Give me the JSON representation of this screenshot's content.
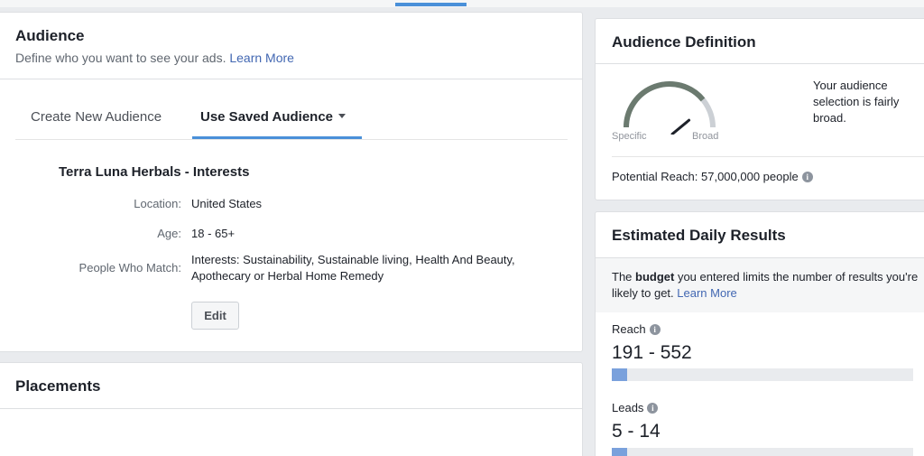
{
  "audience": {
    "title": "Audience",
    "subtitle": "Define who you want to see your ads.",
    "learn_more": "Learn More",
    "tabs": [
      {
        "label": "Create New Audience"
      },
      {
        "label": "Use Saved Audience"
      }
    ],
    "saved_name": "Terra Luna Herbals - Interests",
    "rows": {
      "location": {
        "label": "Location:",
        "value": "United States"
      },
      "age": {
        "label": "Age:",
        "value": "18 - 65+"
      },
      "people": {
        "label": "People Who Match:",
        "value_line1": "Interests: Sustainability, Sustainable living, Health And Beauty,",
        "value_line2": "Apothecary or Herbal Home Remedy"
      }
    },
    "edit_label": "Edit"
  },
  "placements": {
    "title": "Placements"
  },
  "definition": {
    "title": "Audience Definition",
    "gauge_left": "Specific",
    "gauge_right": "Broad",
    "gauge_level": 0.78,
    "description": "Your audience selection is fairly broad.",
    "potential_reach": "Potential Reach: 57,000,000 people"
  },
  "estimated": {
    "title": "Estimated Daily Results",
    "note_before": "The ",
    "note_bold": "budget",
    "note_after": " you entered limits the number of results you're likely to get.",
    "learn_more": "Learn More",
    "metrics": [
      {
        "label": "Reach",
        "value": "191 - 552",
        "fill": 0.05
      },
      {
        "label": "Leads",
        "value": "5 - 14",
        "fill": 0.05
      }
    ]
  },
  "colors": {
    "accent": "#4a90d9",
    "link": "#4267b2",
    "bar_fill": "#7aa1dc"
  }
}
